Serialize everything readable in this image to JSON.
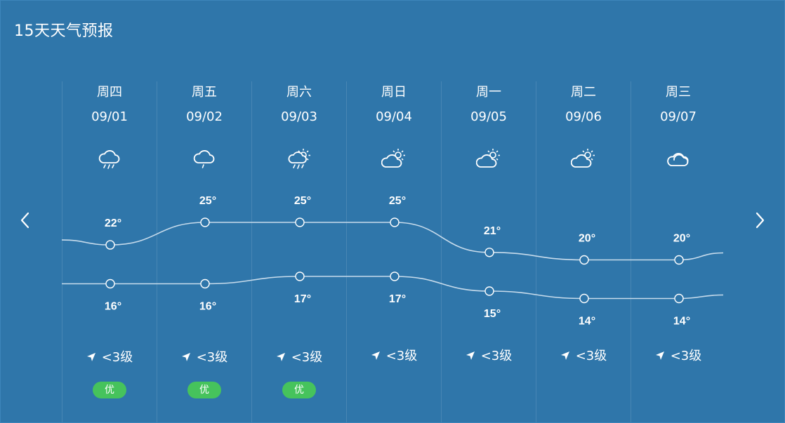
{
  "title": "15天天气预报",
  "nav": {
    "prev_icon": "chevron-left-icon",
    "next_icon": "chevron-right-icon"
  },
  "days": [
    {
      "weekday": "周四",
      "date": "09/01",
      "icon": "cloud-rain-icon",
      "high": "22°",
      "low": "16°",
      "wind": "<3级",
      "aqi": "优"
    },
    {
      "weekday": "周五",
      "date": "09/02",
      "icon": "cloud-drizzle-icon",
      "high": "25°",
      "low": "16°",
      "wind": "<3级",
      "aqi": "优"
    },
    {
      "weekday": "周六",
      "date": "09/03",
      "icon": "sun-cloud-rain-icon",
      "high": "25°",
      "low": "17°",
      "wind": "<3级",
      "aqi": "优"
    },
    {
      "weekday": "周日",
      "date": "09/04",
      "icon": "partly-cloudy-icon",
      "high": "25°",
      "low": "17°",
      "wind": "<3级",
      "aqi": ""
    },
    {
      "weekday": "周一",
      "date": "09/05",
      "icon": "partly-cloudy-icon",
      "high": "21°",
      "low": "15°",
      "wind": "<3级",
      "aqi": ""
    },
    {
      "weekday": "周二",
      "date": "09/06",
      "icon": "partly-cloudy-icon",
      "high": "20°",
      "low": "14°",
      "wind": "<3级",
      "aqi": ""
    },
    {
      "weekday": "周三",
      "date": "09/07",
      "icon": "cloudy-icon",
      "high": "20°",
      "low": "14°",
      "wind": "<3级",
      "aqi": ""
    }
  ],
  "chart_data": {
    "type": "line",
    "categories": [
      "09/01",
      "09/02",
      "09/03",
      "09/04",
      "09/05",
      "09/06",
      "09/07"
    ],
    "series": [
      {
        "values": [
          22,
          25,
          25,
          25,
          21,
          20,
          20
        ]
      },
      {
        "values": [
          16,
          16,
          17,
          17,
          15,
          14,
          14
        ]
      }
    ]
  },
  "colors": {
    "background": "#2f76aa",
    "aqi_good": "#46c35c",
    "line": "#c8dcec"
  }
}
